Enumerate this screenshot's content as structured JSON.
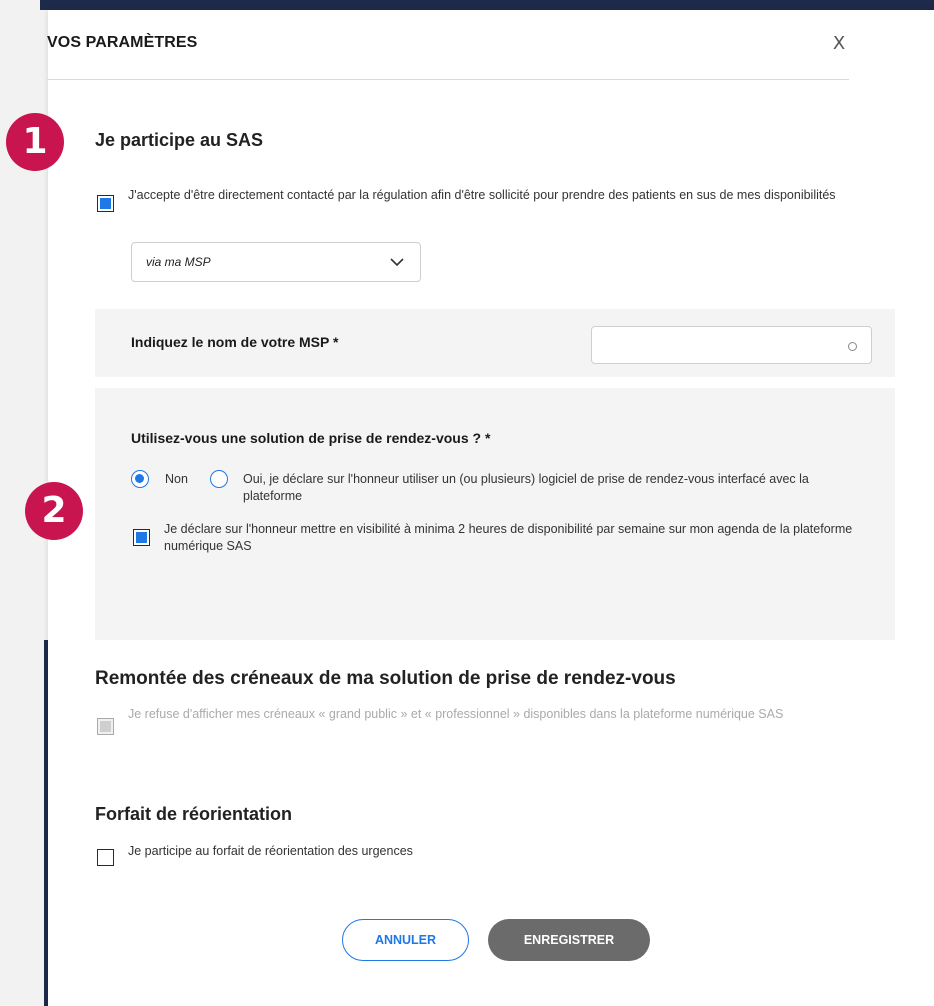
{
  "modal": {
    "title": "VOS PARAMÈTRES",
    "close_label": "X"
  },
  "badges": [
    "1",
    "2"
  ],
  "sas_section": {
    "title": "Je participe au SAS",
    "contact_checkbox": {
      "label": "J'accepte d'être directement contacté par la régulation afin d'être sollicité pour prendre des patients en sus de mes disponibilités",
      "checked": true
    },
    "select": {
      "value": "via ma MSP"
    },
    "msp_field": {
      "label": "Indiquez le nom de votre MSP *",
      "value": "",
      "placeholder": ""
    }
  },
  "rdv_section": {
    "question": "Utilisez-vous une solution de prise de rendez-vous ? *",
    "options": [
      {
        "label": "Non",
        "selected": true
      },
      {
        "label": "Oui, je déclare sur l'honneur utiliser un (ou plusieurs) logiciel de prise de rendez-vous interfacé avec la plateforme",
        "selected": false
      }
    ],
    "declaration_checkbox": {
      "label": "Je déclare sur l'honneur mettre en visibilité à minima 2 heures de disponibilité par semaine sur mon agenda de la plateforme numérique SAS",
      "checked": true
    }
  },
  "remontee_section": {
    "title": "Remontée des créneaux de ma solution de prise de rendez-vous",
    "checkbox": {
      "label": "Je refuse d'afficher mes créneaux « grand public » et « professionnel » disponibles dans la plateforme numérique SAS",
      "checked": false,
      "disabled": true
    }
  },
  "forfait_section": {
    "title": "Forfait de réorientation",
    "checkbox": {
      "label": "Je participe au forfait de réorientation des urgences",
      "checked": false
    }
  },
  "actions": {
    "cancel_label": "ANNULER",
    "save_label": "ENREGISTRER"
  },
  "colors": {
    "accent": "#1e78e6",
    "badge": "#c8144f",
    "save_button": "#6b6b6b",
    "top_bar": "#1e2a4a"
  }
}
